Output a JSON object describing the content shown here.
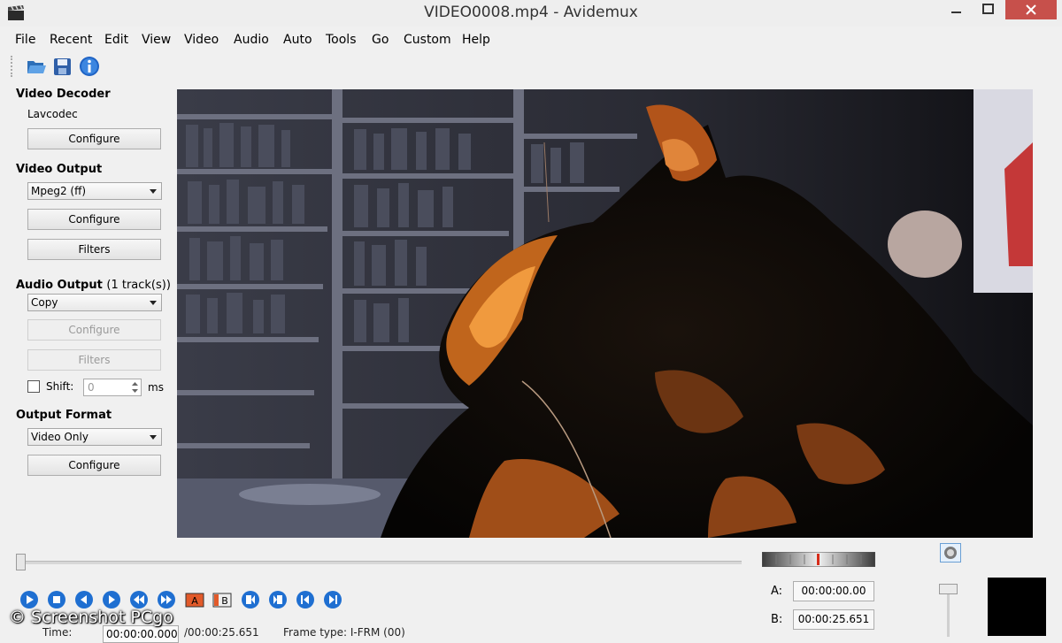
{
  "window": {
    "title": "VIDEO0008.mp4 - Avidemux"
  },
  "menu": [
    "File",
    "Recent",
    "Edit",
    "View",
    "Video",
    "Audio",
    "Auto",
    "Tools",
    "Go",
    "Custom",
    "Help"
  ],
  "toolbar": {
    "icons": [
      "open-folder-icon",
      "save-icon",
      "info-icon"
    ]
  },
  "video_decoder": {
    "title": "Video Decoder",
    "codec": "Lavcodec",
    "configure_label": "Configure"
  },
  "video_output": {
    "title": "Video Output",
    "codec_selected": "Mpeg2 (ff)",
    "configure_label": "Configure",
    "filters_label": "Filters"
  },
  "audio_output": {
    "title": "Audio Output",
    "tracks": "(1 track(s))",
    "codec_selected": "Copy",
    "configure_label": "Configure",
    "filters_label": "Filters",
    "shift_label": "Shift:",
    "shift_value": "0",
    "shift_unit": "ms"
  },
  "output_format": {
    "title": "Output Format",
    "selected": "Video Only",
    "configure_label": "Configure"
  },
  "markers": {
    "a_label": "A:",
    "a_value": "00:00:00.00",
    "b_label": "B:",
    "b_value": "00:00:25.651"
  },
  "status": {
    "time_label": "Time:",
    "time_value": "00:00:00.000",
    "duration": "/00:00:25.651",
    "frame_type": "Frame type: I-FRM (00)"
  },
  "watermark": "© Screenshot PCgo",
  "colors": {
    "titlebar": "#eeeeee",
    "close_button": "#c7504b",
    "accent_blue": "#2f7fd1",
    "marker_red": "#d62c1a"
  }
}
